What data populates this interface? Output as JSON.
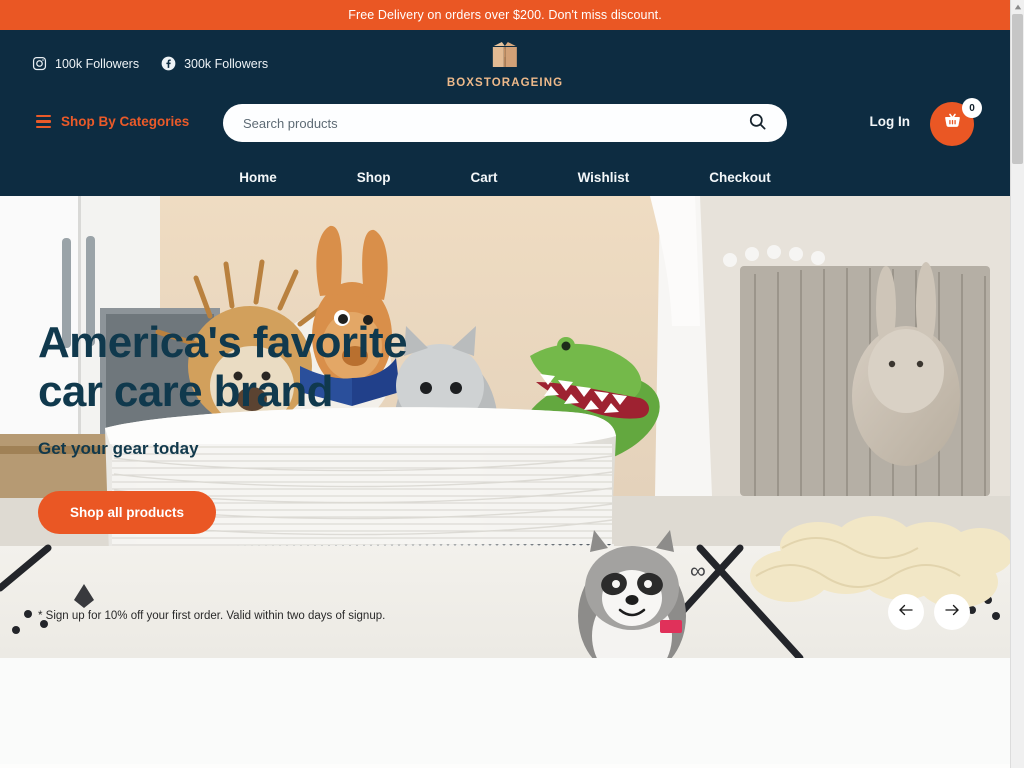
{
  "announcement": {
    "text": "Free Delivery on orders over $200. Don't miss discount."
  },
  "header": {
    "social": [
      {
        "icon": "instagram-icon",
        "label": "100k Followers"
      },
      {
        "icon": "facebook-icon",
        "label": "300k Followers"
      }
    ],
    "logo": {
      "icon": "cardboard-box-icon",
      "wordmark": "BOXSTORAGEING",
      "color": "#edb98a"
    },
    "categories_label": "Shop By Categories",
    "search": {
      "placeholder": "Search products",
      "value": "",
      "icon": "search-icon"
    },
    "login_label": "Log In",
    "cart": {
      "icon": "shopping-basket-icon",
      "count": "0"
    },
    "nav": [
      {
        "label": "Home"
      },
      {
        "label": "Shop"
      },
      {
        "label": "Cart"
      },
      {
        "label": "Wishlist"
      },
      {
        "label": "Checkout"
      }
    ]
  },
  "hero": {
    "heading_line1": "America's favorite",
    "heading_line2": "car care brand",
    "subheading": "Get your gear today",
    "cta_label": "Shop all products",
    "note": "* Sign up for 10% off your first order. Valid within two days of signup.",
    "prev_icon": "arrow-left-icon",
    "next_icon": "arrow-right-icon"
  },
  "theme": {
    "accent": "#ea5724",
    "header_bg": "#0d2c41",
    "heading_color": "#10394d",
    "logo_color": "#edb98a"
  }
}
